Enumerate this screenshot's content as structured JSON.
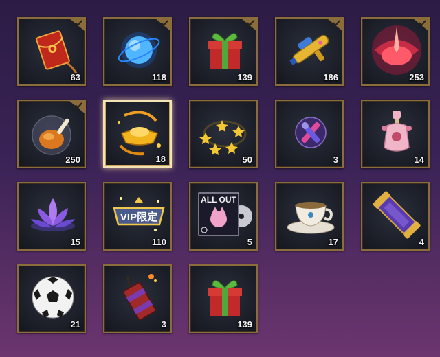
{
  "inventory": {
    "items": [
      {
        "icon": "red-envelope-icon",
        "count": "63",
        "checked": true
      },
      {
        "icon": "blue-orb-icon",
        "count": "118",
        "checked": true
      },
      {
        "icon": "green-gift-box-icon",
        "count": "139",
        "checked": true
      },
      {
        "icon": "water-gun-icon",
        "count": "186",
        "checked": true
      },
      {
        "icon": "crimson-swirl-icon",
        "count": "253",
        "checked": true
      },
      {
        "icon": "roast-chicken-dome-icon",
        "count": "250",
        "checked": true
      },
      {
        "icon": "gold-ingot-icon",
        "count": "18",
        "checked": false,
        "selected": true
      },
      {
        "icon": "star-ring-icon",
        "count": "50",
        "checked": false
      },
      {
        "icon": "purple-x-orb-icon",
        "count": "3",
        "checked": false
      },
      {
        "icon": "perfume-bottle-icon",
        "count": "14",
        "checked": false
      },
      {
        "icon": "purple-lotus-icon",
        "count": "15",
        "checked": false
      },
      {
        "icon": "vip-badge-icon",
        "count": "110",
        "checked": false,
        "badge_text": "VIP限定"
      },
      {
        "icon": "music-album-icon",
        "count": "5",
        "checked": false,
        "album_text": "ALL OUT"
      },
      {
        "icon": "teacup-icon",
        "count": "17",
        "checked": false
      },
      {
        "icon": "scroll-case-icon",
        "count": "4",
        "checked": false
      },
      {
        "icon": "soccer-ball-icon",
        "count": "21",
        "checked": false
      },
      {
        "icon": "firecracker-icon",
        "count": "3",
        "checked": false
      },
      {
        "icon": "green-gift-box-icon",
        "count": "139",
        "checked": false
      }
    ]
  }
}
